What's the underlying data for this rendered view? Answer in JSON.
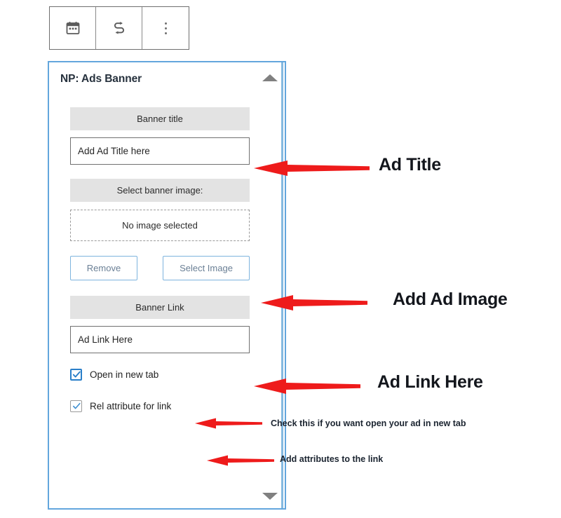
{
  "toolbar": {
    "buttons": [
      {
        "name": "calendar-icon",
        "label": "Calendar block"
      },
      {
        "name": "transform-icon",
        "label": "Transform block"
      },
      {
        "name": "more-options-icon",
        "label": "More options"
      }
    ]
  },
  "panel": {
    "title": "NP: Ads Banner",
    "border_color": "#63a6dd",
    "scroll_up": "scroll up",
    "scroll_down": "scroll down",
    "fields": {
      "banner_title_label": "Banner title",
      "banner_title_value": "Add Ad Title here",
      "banner_title_placeholder": "Add Ad Title here",
      "select_image_label": "Select banner image:",
      "no_image_text": "No image selected",
      "remove_button": "Remove",
      "select_image_button": "Select Image",
      "banner_link_label": "Banner Link",
      "banner_link_value": "Ad Link Here",
      "banner_link_placeholder": "Ad Link Here",
      "open_new_tab_label": "Open in new tab",
      "open_new_tab_checked": true,
      "rel_attribute_label": "Rel attribute for link",
      "rel_attribute_checked": true
    }
  },
  "annotations": {
    "accent_color": "#ee1b1b",
    "ad_title": "Ad Title",
    "add_ad_image": "Add Ad Image",
    "ad_link_here": "Ad Link Here",
    "new_tab_hint": "Check this if you want open your ad in new tab",
    "rel_hint": "Add attributes to the link"
  }
}
